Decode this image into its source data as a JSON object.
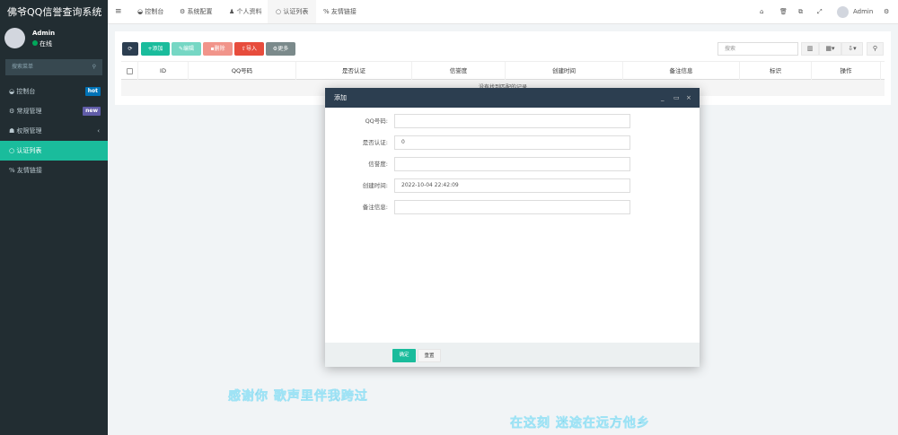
{
  "app": {
    "title": "佛爷QQ信誉查询系统"
  },
  "user": {
    "name": "Admin",
    "status": "在线"
  },
  "sidebar": {
    "search_placeholder": "搜索菜单",
    "items": [
      {
        "label": "控制台",
        "icon": "dashboard-icon",
        "badge": "hot",
        "badge_color": "#0073b7"
      },
      {
        "label": "常规管理",
        "icon": "cogs-icon",
        "badge": "new",
        "badge_color": "#605ca8"
      },
      {
        "label": "权限管理",
        "icon": "group-icon",
        "chevron": "‹"
      },
      {
        "label": "认证列表",
        "icon": "circle-icon",
        "active": true
      },
      {
        "label": "友情链接",
        "icon": "link-icon"
      }
    ]
  },
  "topbar": {
    "tabs": [
      {
        "label": "控制台"
      },
      {
        "label": "系统配置"
      },
      {
        "label": "个人资料"
      },
      {
        "label": "认证列表",
        "active": true
      },
      {
        "label": "友情链接"
      }
    ],
    "user": "Admin"
  },
  "toolbar": {
    "add": "添加",
    "edit": "编辑",
    "delete": "删除",
    "import": "导入",
    "more": "更多",
    "search_placeholder": "搜索"
  },
  "table": {
    "columns": [
      "ID",
      "QQ号码",
      "是否认证",
      "信誉度",
      "创建时间",
      "备注信息",
      "标识",
      "操作"
    ],
    "empty": "没有找到匹配的记录"
  },
  "modal": {
    "title": "添加",
    "fields": [
      {
        "label": "QQ号码:",
        "value": ""
      },
      {
        "label": "是否认证:",
        "value": "0"
      },
      {
        "label": "信誉度:",
        "value": ""
      },
      {
        "label": "创建时间:",
        "value": "2022-10-04 22:42:09"
      },
      {
        "label": "备注信息:",
        "value": ""
      }
    ],
    "confirm": "确定",
    "reset": "重置"
  },
  "lyrics": [
    "感谢你  歌声里伴我跨过",
    "在这刻  迷途在远方他乡"
  ],
  "colors": {
    "sidebar": "#222d32",
    "accent": "#1abc9c",
    "modal_header": "#2c3e50",
    "danger": "#e74c3c"
  }
}
